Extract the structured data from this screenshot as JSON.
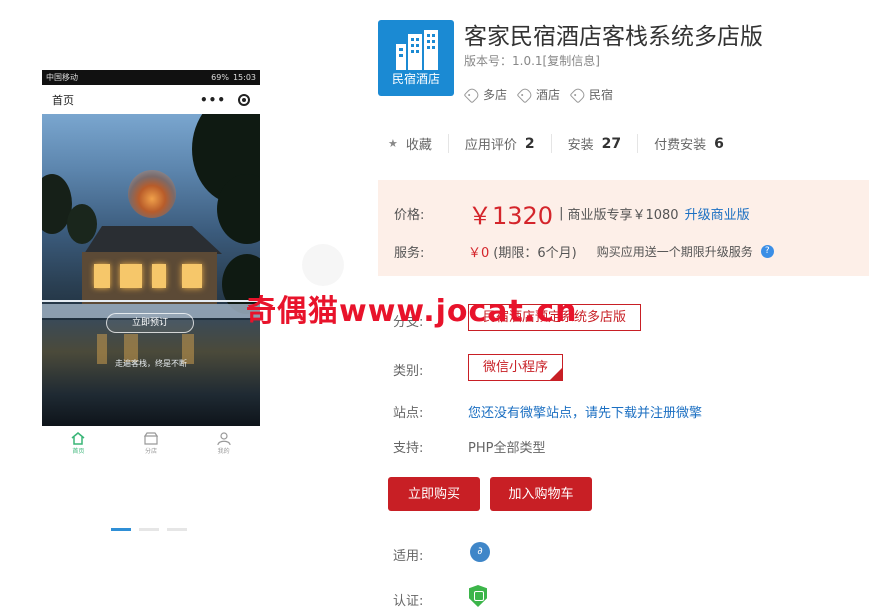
{
  "phone": {
    "status_bar": {
      "carrier": "中国移动",
      "battery": "69%",
      "time": "15:03"
    },
    "header_title": "首页",
    "hero_button": "立即预订",
    "hero_slogan": "走遍客栈，终是不断",
    "tabs": [
      {
        "label": "首页",
        "icon": "home-icon"
      },
      {
        "label": "分店",
        "icon": "store-icon"
      },
      {
        "label": "我的",
        "icon": "user-icon"
      }
    ]
  },
  "carousel": {
    "count": 3,
    "active_index": 0
  },
  "app": {
    "logo_text": "民宿酒店",
    "title": "客家民宿酒店客栈系统多店版",
    "version": "版本号：1.0.1[复制信息]",
    "tags": [
      "多店",
      "酒店",
      "民宿"
    ]
  },
  "stats": {
    "favorite_label": "收藏",
    "rating_label": "应用评价",
    "rating_count": "2",
    "install_label": "安装",
    "install_count": "27",
    "paid_label": "付费安装",
    "paid_count": "6"
  },
  "pricing": {
    "price_label": "价格:",
    "price": "￥1320",
    "separator": "|",
    "pro_price": "商业版专享￥1080",
    "upgrade_link": "升级商业版",
    "service_label": "服务:",
    "service_value": "￥0",
    "service_period": "(期限：6个月)",
    "service_note": "购买应用送一个期限升级服务"
  },
  "details": {
    "branch_label": "分支:",
    "branch_value": "民宿酒店预定系统多店版",
    "category_label": "类别:",
    "category_value": "微信小程序",
    "site_label": "站点:",
    "site_value": "您还没有微擎站点，请先下载并注册微擎",
    "support_label": "支持:",
    "support_value": "PHP全部类型",
    "fit_label": "适用:",
    "cert_label": "认证:"
  },
  "actions": {
    "buy": "立即购买",
    "cart": "加入购物车"
  },
  "watermark": "奇偶猫www.jocat.cn",
  "colors": {
    "accent_red": "#c81f25",
    "link_blue": "#1b6fc2",
    "logo_blue": "#1b8ad3",
    "price_bg": "#fdefe8",
    "tab_active": "#39b577"
  }
}
